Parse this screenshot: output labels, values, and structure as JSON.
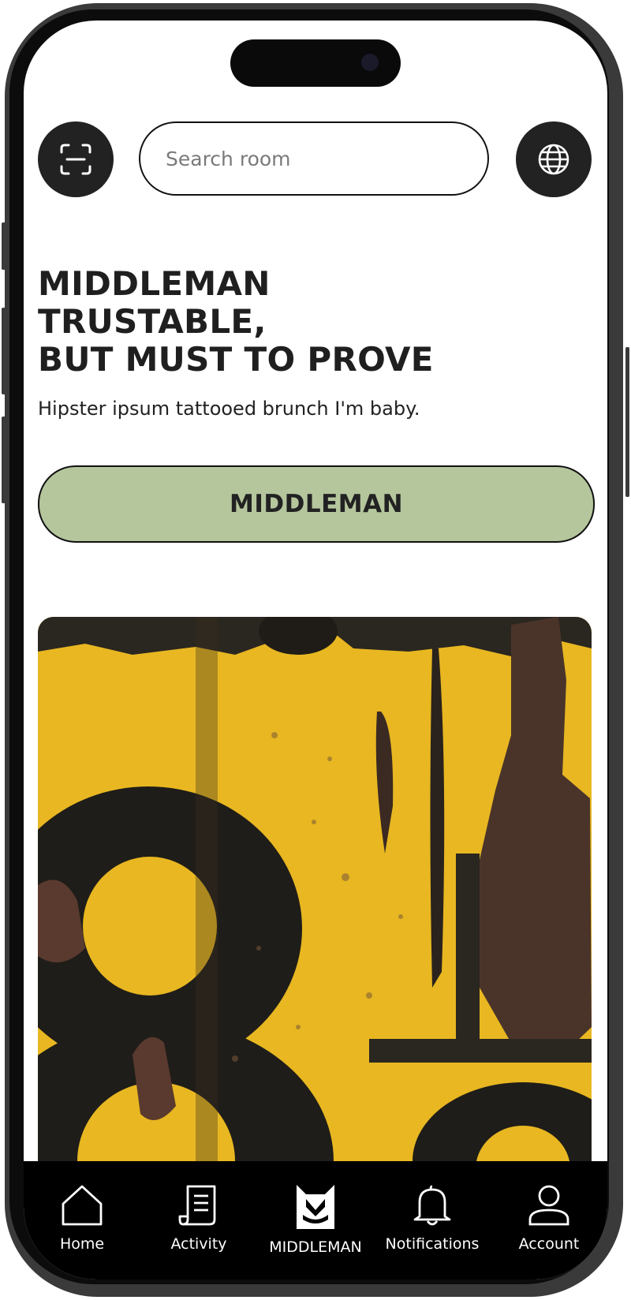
{
  "search": {
    "placeholder": "Search room"
  },
  "icons": {
    "left": "scan-icon",
    "right": "globe-icon"
  },
  "hero": {
    "title_lines": [
      "MIDDLEMAN",
      "TRUSTABLE,",
      "BUT MUST TO PROVE"
    ],
    "subtitle": "Hipster ipsum tattooed brunch I'm baby."
  },
  "cta": {
    "label": "MIDDLEMAN",
    "color": "#b5c69d"
  },
  "tabs": [
    {
      "label": "Home",
      "icon": "home-icon"
    },
    {
      "label": "Activity",
      "icon": "receipt-icon"
    },
    {
      "label": "MIDDLEMAN",
      "icon": "middleman-logo-icon"
    },
    {
      "label": "Notifications",
      "icon": "bell-icon"
    },
    {
      "label": "Account",
      "icon": "user-icon"
    }
  ],
  "colors": {
    "accent_green": "#b5c69d",
    "dark": "#222222",
    "image_yellow": "#e8b721"
  }
}
